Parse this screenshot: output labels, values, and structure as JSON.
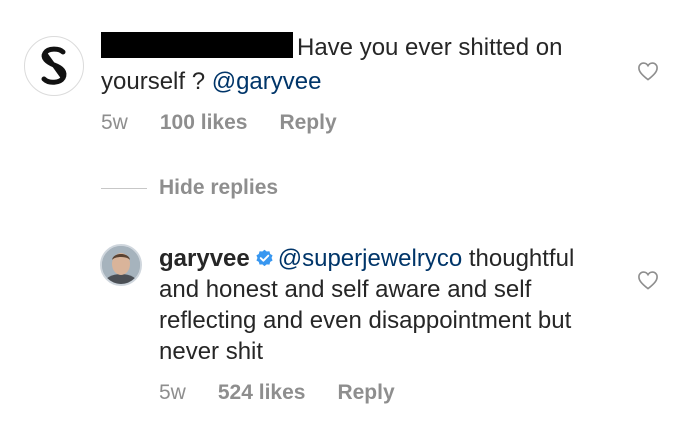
{
  "comment1": {
    "text": "Have you ever shitted on yourself ? ",
    "mention": "@garyvee",
    "age": "5w",
    "likes": "100 likes",
    "reply": "Reply"
  },
  "replies": {
    "toggle_label": "Hide replies"
  },
  "reply1": {
    "username": "garyvee",
    "mention": "@superjewelryco",
    "text": " thoughtful and honest and self aware and self reflecting and even disappointment but never shit",
    "age": "5w",
    "likes": "524 likes",
    "reply": "Reply"
  },
  "icons": {
    "like": "heart-outline-icon",
    "verified": "verified-badge-icon",
    "brand": "s-logo"
  },
  "colors": {
    "mention": "#003569",
    "verified": "#3897f0",
    "meta": "#8e8e8e"
  }
}
